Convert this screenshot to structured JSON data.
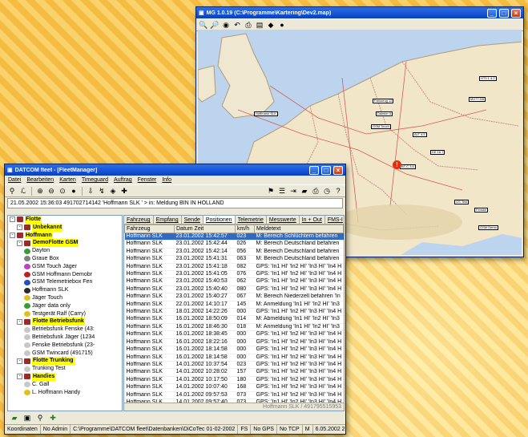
{
  "map_window": {
    "title": "MG 1.0.19 (C:\\Programme\\Kartering\\Dev2.map)",
    "vehicles": [
      "HT5 1.4.2",
      "Fahrzeug 12",
      "Hoffmann SLK",
      "Daimler 5",
      "MV77 DB",
      "GSM Touch",
      "ALT 4.5",
      "DE 16.7",
      "BT-C 3.6",
      "GS Test",
      "Fenske",
      "GSM Demo"
    ]
  },
  "fleet_window": {
    "title": "DATCOM fleet - [FleetManager]",
    "menu": [
      "Datei",
      "Bearbeiten",
      "Karten",
      "Timeguard",
      "Auftrag",
      "Fenster",
      "Info"
    ],
    "address": "21.05.2002 15:36:03 491702714142 'Hoffmann SLK ' > in: Meldung BIN IN HOLLAND",
    "tree": [
      {
        "label": "Flotte",
        "level": 0,
        "hl": true,
        "color": "#9b2b2b"
      },
      {
        "label": "Unbekannt",
        "level": 1,
        "hl": true,
        "color": "#9b2b2b"
      },
      {
        "label": "Hoffmann",
        "level": 0,
        "hl": true,
        "color": "#9b2b2b"
      },
      {
        "label": "DemoFlotte GSM",
        "level": 1,
        "hl": true,
        "color": "#9b2b2b"
      },
      {
        "label": "Dayton",
        "level": 2,
        "hl": false,
        "color": "#3a9a3a"
      },
      {
        "label": "Graue Box",
        "level": 2,
        "hl": false,
        "color": "#808080"
      },
      {
        "label": "GSM Touch Jäger",
        "level": 2,
        "hl": false,
        "color": "#c03fc0"
      },
      {
        "label": "GSM Hoffmann Demobr",
        "level": 2,
        "hl": false,
        "color": "#c02020"
      },
      {
        "label": "GSM Telemetriebox Fen",
        "level": 2,
        "hl": false,
        "color": "#2050c0"
      },
      {
        "label": "Hoffmann SLK",
        "level": 2,
        "hl": false,
        "color": "#2a2a2a"
      },
      {
        "label": "Jäger Touch",
        "level": 2,
        "hl": false,
        "color": "#e0c020"
      },
      {
        "label": "Jäger data only",
        "level": 2,
        "hl": false,
        "color": "#3a9a3a"
      },
      {
        "label": "Testgerät Ralf (Carry)",
        "level": 2,
        "hl": false,
        "color": "#e0c020"
      },
      {
        "label": "Flotte Betriebsfunk",
        "level": 1,
        "hl": true,
        "color": "#9b2b2b"
      },
      {
        "label": "Betriebsfunk Fenske (43:",
        "level": 2,
        "hl": false,
        "color": "#c8c8c8"
      },
      {
        "label": "Betriebsfunk Jäger (1234",
        "level": 2,
        "hl": false,
        "color": "#c8c8c8"
      },
      {
        "label": "Fenske Betriebsfunk (23-",
        "level": 2,
        "hl": false,
        "color": "#c8c8c8"
      },
      {
        "label": "GSM Twincard (491715)",
        "level": 2,
        "hl": false,
        "color": "#c8c8c8"
      },
      {
        "label": "Flotte Trunking",
        "level": 1,
        "hl": true,
        "color": "#9b2b2b"
      },
      {
        "label": "Trunking Test",
        "level": 2,
        "hl": false,
        "color": "#c8c8c8"
      },
      {
        "label": "Handies",
        "level": 1,
        "hl": true,
        "color": "#9b2b2b"
      },
      {
        "label": "C. Gall",
        "level": 2,
        "hl": false,
        "color": "#c8c8c8"
      },
      {
        "label": "L. Hoffmann Handy",
        "level": 2,
        "hl": false,
        "color": "#e0c020"
      }
    ],
    "tabs": [
      "Fahrzeug",
      "Empfang",
      "Sende",
      "Positionen",
      "Telemetrie",
      "Messwerte",
      "In + Out",
      "FMS-I"
    ],
    "columns": [
      "Fahrzeug",
      "Datum Zeit",
      "km/h",
      "Meldetext"
    ],
    "rows": [
      [
        "Hoffmann SLK",
        "23.01.2002 15:42:57",
        "023",
        "M: Bereich Schlüchtern befahren"
      ],
      [
        "Hoffmann SLK",
        "23.01.2002 15:42:44",
        "026",
        "M: Bereich Deutschland befahren"
      ],
      [
        "Hoffmann SLK",
        "23.01.2002 15:42:14",
        "056",
        "M: Bereich Deutschland befahren"
      ],
      [
        "Hoffmann SLK",
        "23.01.2002 15:41:31",
        "063",
        "M: Bereich Deutschland befahren"
      ],
      [
        "Hoffmann SLK",
        "23.01.2002 15:41:18",
        "082",
        "GPS: 'In1 HI' 'In2 HI' 'In3 HI' 'In4 H"
      ],
      [
        "Hoffmann SLK",
        "23.01.2002 15:41:05",
        "076",
        "GPS: 'In1 HI' 'In2 HI' 'In3 HI' 'In4 H"
      ],
      [
        "Hoffmann SLK",
        "23.01.2002 15:40:53",
        "062",
        "GPS: 'In1 HI' 'In2 HI' 'In3 HI' 'In4 H"
      ],
      [
        "Hoffmann SLK",
        "23.01.2002 15:40:40",
        "080",
        "GPS: 'In1 HI' 'In2 HI' 'In3 HI' 'In4 H"
      ],
      [
        "Hoffmann SLK",
        "23.01.2002 15:40:27",
        "067",
        "M: Bereich Niederzell befahren 'In"
      ],
      [
        "Hoffmann SLK",
        "22.01.2002 14:10:17",
        "145",
        "M: Anmeldung 'In1 HI' 'In2 HI' 'In3"
      ],
      [
        "Hoffmann SLK",
        "18.01.2002 14:22:26",
        "000",
        "GPS: 'In1 HI' 'In2 HI' 'In3 HI' 'In4 H"
      ],
      [
        "Hoffmann SLK",
        "16.01.2002 18:50:09",
        "014",
        "M: Abmeldung 'In1 HI' 'In2 HI' 'In3"
      ],
      [
        "Hoffmann SLK",
        "16.01.2002 18:46:30",
        "018",
        "M: Anmeldung 'In1 HI' 'In2 HI' 'In3"
      ],
      [
        "Hoffmann SLK",
        "16.01.2002 18:38:45",
        "000",
        "GPS: 'In1 HI' 'In2 HI' 'In3 HI' 'In4 H"
      ],
      [
        "Hoffmann SLK",
        "16.01.2002 18:22:16",
        "000",
        "GPS: 'In1 HI' 'In2 HI' 'In3 HI' 'In4 H"
      ],
      [
        "Hoffmann SLK",
        "16.01.2002 18:14:58",
        "000",
        "GPS: 'In1 HI' 'In2 HI' 'In3 HI' 'In4 H"
      ],
      [
        "Hoffmann SLK",
        "16.01.2002 18:14:58",
        "000",
        "GPS: 'In1 HI' 'In2 HI' 'In3 HI' 'In4 H"
      ],
      [
        "Hoffmann SLK",
        "14.01.2002 10:37:54",
        "023",
        "GPS: 'In1 HI' 'In2 HI' 'In3 HI' 'In4 H"
      ],
      [
        "Hoffmann SLK",
        "14.01.2002 10:28:02",
        "157",
        "GPS: 'In1 HI' 'In2 HI' 'In3 HI' 'In4 H"
      ],
      [
        "Hoffmann SLK",
        "14.01.2002 10:17:50",
        "180",
        "GPS: 'In1 HI' 'In2 HI' 'In3 HI' 'In4 H"
      ],
      [
        "Hoffmann SLK",
        "14.01.2002 10:07:40",
        "168",
        "GPS: 'In1 HI' 'In2 HI' 'In3 HI' 'In4 H"
      ],
      [
        "Hoffmann SLK",
        "14.01.2002 09:57:53",
        "073",
        "GPS: 'In1 HI' 'In2 HI' 'In3 HI' 'In4 H"
      ],
      [
        "Hoffmann SLK",
        "14.01.2002 09:57:40",
        "073",
        "GPS: 'In1 HI' 'In2 HI' 'In3 HI' 'In4 H"
      ]
    ],
    "grid_status": "Hoffmann SLK / 491795515953",
    "status_bar": [
      "Koordinaten",
      "No Admin",
      "C:\\Programme\\DATCOM fleet\\Datenbanken\\DiCoTec 01-02-2002",
      "FS",
      "No GPS",
      "No TCP",
      "M",
      "6.05.2002 2"
    ]
  }
}
